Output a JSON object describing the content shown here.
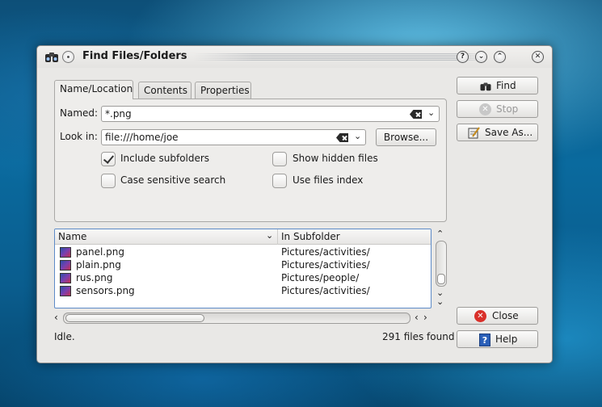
{
  "window": {
    "title": "Find Files/Folders",
    "title_buttons": [
      "?",
      "⌄",
      "⌃",
      "✕"
    ]
  },
  "tabs": [
    {
      "label": "Name/Location",
      "active": true
    },
    {
      "label": "Contents",
      "active": false
    },
    {
      "label": "Properties",
      "active": false
    }
  ],
  "form": {
    "named_label": "Named:",
    "named_value": "*.png",
    "lookin_label": "Look in:",
    "lookin_value": "file:///home/joe",
    "browse_label": "Browse...",
    "checkboxes": [
      {
        "label": "Include subfolders",
        "checked": true
      },
      {
        "label": "Case sensitive search",
        "checked": false
      },
      {
        "label": "Show hidden files",
        "checked": false
      },
      {
        "label": "Use files index",
        "checked": false
      }
    ]
  },
  "results": {
    "columns": [
      "Name",
      "In Subfolder"
    ],
    "rows": [
      {
        "name": "panel.png",
        "folder": "Pictures/activities/"
      },
      {
        "name": "plain.png",
        "folder": "Pictures/activities/"
      },
      {
        "name": "rus.png",
        "folder": "Pictures/people/"
      },
      {
        "name": "sensors.png",
        "folder": "Pictures/activities/"
      }
    ]
  },
  "actions": {
    "find": "Find",
    "stop": "Stop",
    "save_as": "Save As...",
    "close": "Close",
    "help": "Help"
  },
  "status": {
    "state": "Idle.",
    "count": "291 files found"
  },
  "colors": {
    "selection_border": "#5e8bc7",
    "close_icon": "#d9302a",
    "help_icon": "#2a5fb8"
  }
}
